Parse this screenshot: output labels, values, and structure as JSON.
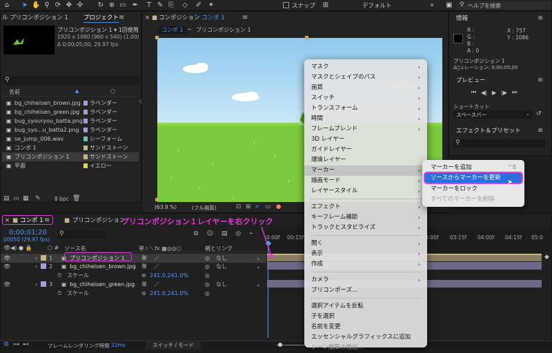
{
  "toolbar": {
    "snap_label": "スナップ",
    "workspace_label": "デフォルト",
    "help_placeholder": "ヘルプを検索"
  },
  "project_panel": {
    "tab_left": "ル プリコンポジション 1",
    "tab_active": "プロジェクト",
    "thumb_name": "プリコンポジション 1 ▾ 1回使用",
    "thumb_info1": "1920 x 1080 (960 x 540) (1.00)",
    "thumb_info2": "Δ 0;00;05;00, 29.97 fps",
    "col_name": "名前",
    "items": [
      {
        "name": "bg_chiheisen_brown.jpg",
        "label": "ラベンダー",
        "color": "#a3a0d9"
      },
      {
        "name": "bg_chiheisen_green.jpg",
        "label": "ラベンダー",
        "color": "#a3a0d9"
      },
      {
        "name": "bug_syouryou_batta.png",
        "label": "ラベンダー",
        "color": "#a3a0d9"
      },
      {
        "name": "bug_syo...u_batta2.png",
        "label": "ラベンダー",
        "color": "#a3a0d9"
      },
      {
        "name": "se_jump_006.wav",
        "label": "シーフォーム",
        "color": "#6fc2b3"
      },
      {
        "name": "コンポ 1",
        "label": "サンドストーン",
        "color": "#c7b28e"
      },
      {
        "name": "プリコンポジション 1",
        "label": "サンドストーン",
        "color": "#c7b28e"
      },
      {
        "name": "平面",
        "label": "イエロー",
        "color": "#e4d84c"
      }
    ],
    "bpc": "8 bpc"
  },
  "comp_panel": {
    "title": "コンポジション",
    "title_link": "コンポ 1",
    "crumb_active": "コンポ 1",
    "crumb_sep": "←",
    "crumb_other": "プリコンポジション 1",
    "zoom": "(63.9 %)",
    "quality": "(フル画質)"
  },
  "context_menu": {
    "items": [
      {
        "label": "マスク",
        "sub": true
      },
      {
        "label": "マスクとシェイプのパス",
        "sub": true
      },
      {
        "label": "画質",
        "sub": true
      },
      {
        "label": "スイッチ",
        "sub": true
      },
      {
        "label": "トランスフォーム",
        "sub": true
      },
      {
        "label": "時間",
        "sub": true
      },
      {
        "label": "フレームブレンド",
        "sub": true
      },
      {
        "label": "3D レイヤー",
        "sub": false
      },
      {
        "label": "ガイドレイヤー",
        "sub": false
      },
      {
        "label": "環境レイヤー",
        "sub": false
      },
      {
        "label": "マーカー",
        "sub": true,
        "highlighted": true
      },
      {
        "label": "描画モード",
        "sub": true
      },
      {
        "label": "レイヤースタイル",
        "sub": true
      },
      {
        "label": "エフェクト",
        "sub": true
      },
      {
        "label": "キーフレーム補助",
        "sub": true
      },
      {
        "label": "トラックとスタビライズ",
        "sub": true
      },
      {
        "label": "開く",
        "sub": true
      },
      {
        "label": "表示",
        "sub": true
      },
      {
        "label": "作成",
        "sub": true
      },
      {
        "label": "カメラ",
        "sub": true
      },
      {
        "label": "プリコンポーズ...",
        "sub": false
      },
      {
        "label": "選択アイテムを反転",
        "sub": false
      },
      {
        "label": "子を選択",
        "sub": false
      },
      {
        "label": "名前を変更",
        "sub": false
      },
      {
        "label": "エッセンシャルグラフィックスに追加",
        "sub": false
      },
      {
        "label": "シーン編集の検出...",
        "sub": false,
        "disabled": true
      }
    ]
  },
  "marker_submenu": {
    "add": "マーカーを追加",
    "add_shortcut": "^8",
    "update": "ソースからマーカーを更新",
    "lock": "マーカーをロック",
    "delete_all": "すべてのマーカーを削除"
  },
  "info_panel": {
    "title": "情報",
    "r": "R :",
    "g": "G :",
    "b": "B :",
    "a": "A : 0",
    "x": "X : 757",
    "y": "Y : 1086",
    "comp_name": "プリコンポジション 1",
    "duration": "Δ゙ュレーション: 0;00;05;00"
  },
  "preview_panel": {
    "title": "プレビュー",
    "shortcut_label": "ショートカット",
    "shortcut_value": "スペースバー"
  },
  "effects_panel": {
    "title": "エフェクト＆プリセット"
  },
  "timeline": {
    "tab_active": "コンポ 1",
    "tab_other": "プリコンポジション",
    "timecode": "0;00;01;20",
    "frames": "00050 (29.97 fps)",
    "col_source": "ソース名",
    "col_parent": "親とリンク",
    "layers": [
      {
        "num": "1",
        "name": "プリコンポジション 1",
        "parent": "なし",
        "color": "#c7b28e"
      },
      {
        "num": "2",
        "name": "bg_chiheisen_brown.jpg",
        "parent": "なし",
        "color": "#a3a0d9"
      },
      {
        "num": "3",
        "name": "bg_chiheisen_green.jpg",
        "parent": "なし",
        "color": "#a3a0d9"
      }
    ],
    "scale_label": "スケール",
    "scale_value": "241.0,241.0%",
    "ruler": [
      "0:00f",
      "00:15f",
      "3:00f",
      "03:15f",
      "04:00f",
      "04:15f",
      "05:0"
    ],
    "render_time_label": "フレームレンダリング時間",
    "render_time_value": "22ms",
    "switch_mode": "スイッチ / モード"
  },
  "annotation": {
    "text": "プリコンポジション１レイヤーを右クリック",
    "color": "#e23ad6"
  }
}
